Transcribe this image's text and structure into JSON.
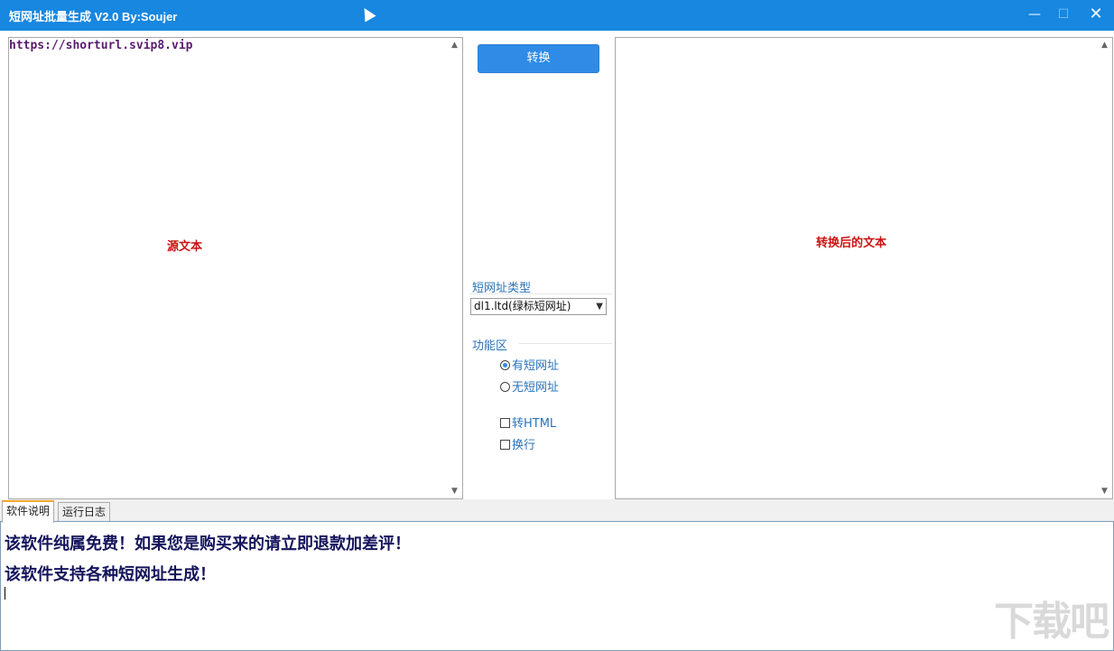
{
  "window": {
    "title": "短网址批量生成   V2.0 By:Soujer",
    "min_glyph": "—",
    "max_glyph": "☐",
    "close_glyph": "✕"
  },
  "source": {
    "text": "https://shorturl.svip8.vip",
    "label": "源文本"
  },
  "result": {
    "text": "",
    "label": "转换后的文本"
  },
  "controls": {
    "convert_label": "转换",
    "type_group_label": "短网址类型",
    "type_selected": "dl1.ltd(绿标短网址)",
    "function_group_label": "功能区",
    "radio_with": "有短网址",
    "radio_without": "无短网址",
    "check_html": "转HTML",
    "check_newline": "换行"
  },
  "tabs": [
    {
      "label": "软件说明",
      "active": true
    },
    {
      "label": "运行日志",
      "active": false
    }
  ],
  "log": {
    "lines": [
      "该软件纯属免费！如果您是购买来的请立即退款加差评！",
      "该软件支持各种短网址生成！"
    ]
  },
  "watermark": "下载吧",
  "colors": {
    "titlebar": "#1787e0",
    "accent": "#2f8be6",
    "label_red": "#cc1111",
    "group_blue": "#2a73b8",
    "log_text": "#14145c"
  }
}
